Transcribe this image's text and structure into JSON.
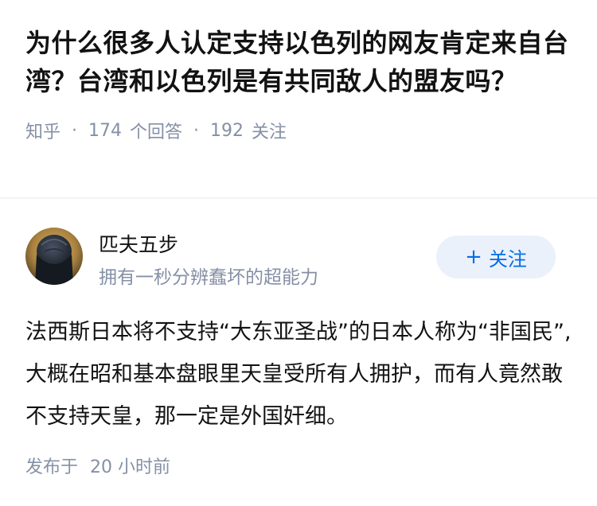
{
  "question": {
    "title": "为什么很多人认定支持以色列的网友肯定来自台湾？台湾和以色列是有共同敌人的盟友吗？",
    "source": "知乎",
    "answer_count": "174",
    "answer_label": "个回答",
    "follow_count": "192",
    "follow_label": "关注"
  },
  "answer": {
    "author_name": "匹夫五步",
    "author_bio": "拥有一秒分辨蠢坏的超能力",
    "follow_button_label": "关注",
    "follow_button_icon": "plus-icon",
    "content": "法西斯日本将不支持“大东亚圣战”的日本人称为“非国民”,大概在昭和基本盘眼里天皇受所有人拥护，而有人竟然敢不支持天皇，那一定是外国奸细。",
    "published_prefix": "发布于",
    "published_time": "20 小时前"
  },
  "colors": {
    "text_primary": "#121212",
    "text_secondary": "#8590a6",
    "brand_blue": "#056de8",
    "button_bg": "#eaf1fb",
    "divider": "#f3f3f3"
  }
}
